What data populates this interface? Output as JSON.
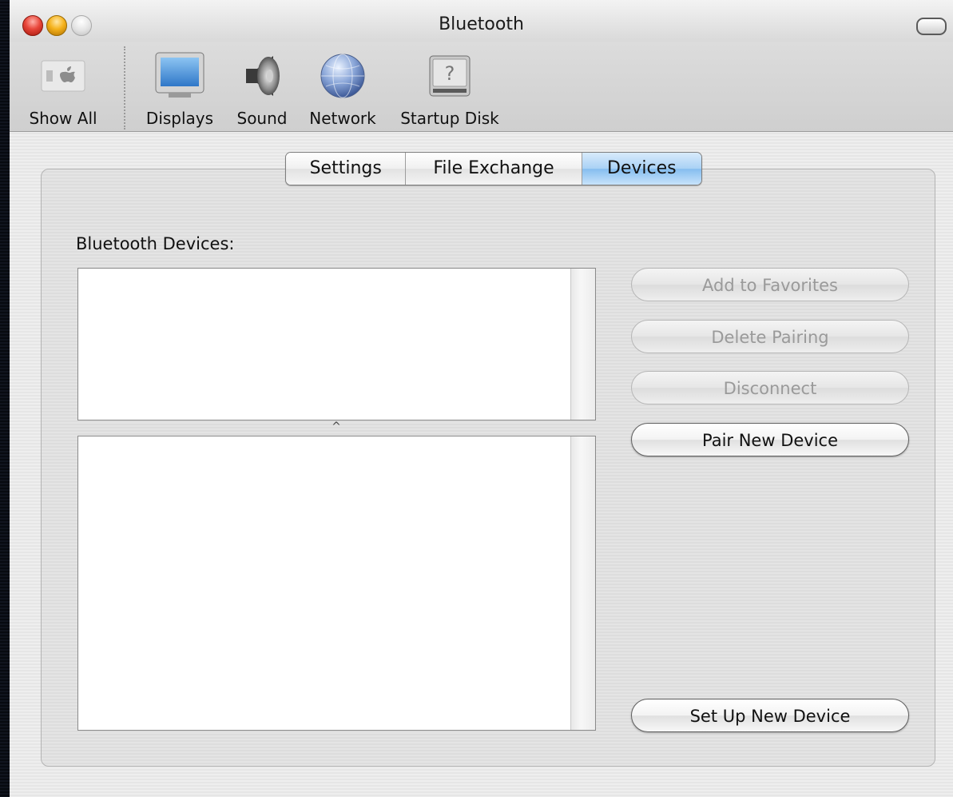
{
  "window": {
    "title": "Bluetooth"
  },
  "toolbar": {
    "items": [
      {
        "label": "Show All",
        "icon": "apple-grid-icon"
      },
      {
        "label": "Displays",
        "icon": "monitor-icon"
      },
      {
        "label": "Sound",
        "icon": "speaker-icon"
      },
      {
        "label": "Network",
        "icon": "globe-icon"
      },
      {
        "label": "Startup Disk",
        "icon": "hard-disk-icon"
      }
    ]
  },
  "tabs": [
    {
      "label": "Settings",
      "selected": false
    },
    {
      "label": "File Exchange",
      "selected": false
    },
    {
      "label": "Devices",
      "selected": true
    }
  ],
  "devices": {
    "section_label": "Bluetooth Devices:",
    "buttons": {
      "add_to_favorites": "Add to Favorites",
      "delete_pairing": "Delete Pairing",
      "disconnect": "Disconnect",
      "pair_new_device": "Pair New Device",
      "set_up_new_device": "Set Up New Device"
    }
  },
  "colors": {
    "selected_tab": "#a9d1f5",
    "close_button": "#e8463a",
    "minimize_button": "#f5b21c"
  }
}
